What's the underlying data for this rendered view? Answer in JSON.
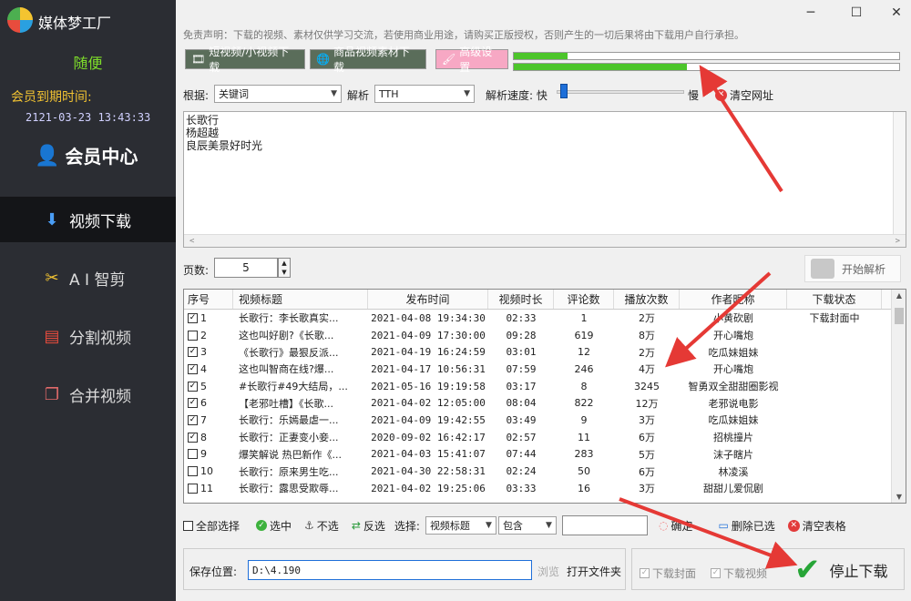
{
  "app": {
    "title": "媒体梦工厂",
    "user": "随便",
    "expiry_label": "会员到期时间:",
    "expiry_value": "2121-03-23 13:43:33",
    "member_center": "会员中心"
  },
  "nav": {
    "items": [
      {
        "label": "视频下载",
        "icon": "down-arrow-icon",
        "active": true
      },
      {
        "label": "A I 智剪",
        "icon": "ai-clip-icon",
        "active": false
      },
      {
        "label": "分割视频",
        "icon": "split-video-icon",
        "active": false
      },
      {
        "label": "合并视频",
        "icon": "merge-video-icon",
        "active": false
      }
    ]
  },
  "window": {
    "minimize": "─",
    "maximize": "☐",
    "close": "✕"
  },
  "disclaimer": "免责声明：下载的视频、素材仅供学习交流，若使用商业用途，请购买正版授权，否则产生的一切后果将由下载用户自行承担。",
  "top_buttons": {
    "short_video": "短视频/小视频下载",
    "product_material": "商品视频素材下载",
    "advanced": "高级设置"
  },
  "progress": {
    "bar1": 0.14,
    "bar2": 0.45
  },
  "parse_options": {
    "by_label": "根据:",
    "by_value": "关键词",
    "parse_label": "解析",
    "parse_value": "TTH",
    "speed_label": "解析速度: 快",
    "speed_slow": "慢",
    "speed_level": 0.03,
    "clear_url": "清空网址"
  },
  "url_lines": [
    "长歌行",
    "杨超越",
    "良辰美景好时光"
  ],
  "pages": {
    "label": "页数:",
    "value": "5",
    "start_parse": "开始解析"
  },
  "table": {
    "columns": [
      "序号",
      "视频标题",
      "发布时间",
      "视频时长",
      "评论数",
      "播放次数",
      "作者昵称",
      "下载状态"
    ],
    "rows": [
      {
        "checked": true,
        "no": "1",
        "title": "长歌行：李长歌真实...",
        "time": "2021-04-08 19:34:30",
        "dur": "02:33",
        "comments": "1",
        "plays": "2万",
        "author": "小黄砍剧",
        "status": "下载封面中"
      },
      {
        "checked": false,
        "no": "2",
        "title": "这也叫好剧?《长歌...",
        "time": "2021-04-09 17:30:00",
        "dur": "09:28",
        "comments": "619",
        "plays": "8万",
        "author": "开心嘴炮",
        "status": ""
      },
      {
        "checked": true,
        "no": "3",
        "title": "《长歌行》最狠反派...",
        "time": "2021-04-19 16:24:59",
        "dur": "03:01",
        "comments": "12",
        "plays": "2万",
        "author": "吃瓜妹姐妹",
        "status": ""
      },
      {
        "checked": true,
        "no": "4",
        "title": "这也叫智商在线?爆...",
        "time": "2021-04-17 10:56:31",
        "dur": "07:59",
        "comments": "246",
        "plays": "4万",
        "author": "开心嘴炮",
        "status": ""
      },
      {
        "checked": true,
        "no": "5",
        "title": "#长歌行#49大结局，...",
        "time": "2021-05-16 19:19:58",
        "dur": "03:17",
        "comments": "8",
        "plays": "3245",
        "author": "智勇双全甜甜圈影视",
        "status": ""
      },
      {
        "checked": true,
        "no": "6",
        "title": "【老邪吐槽】《长歌...",
        "time": "2021-04-02 12:05:00",
        "dur": "08:04",
        "comments": "822",
        "plays": "12万",
        "author": "老邪说电影",
        "status": ""
      },
      {
        "checked": true,
        "no": "7",
        "title": "长歌行：乐嫣最虐一...",
        "time": "2021-04-09 19:42:55",
        "dur": "03:49",
        "comments": "9",
        "plays": "3万",
        "author": "吃瓜妹姐妹",
        "status": ""
      },
      {
        "checked": true,
        "no": "8",
        "title": "长歌行：正妻变小妾...",
        "time": "2020-09-02 16:42:17",
        "dur": "02:57",
        "comments": "11",
        "plays": "6万",
        "author": "招桃撞片",
        "status": ""
      },
      {
        "checked": false,
        "no": "9",
        "title": "爆笑解说 热巴新作《...",
        "time": "2021-04-03 15:41:07",
        "dur": "07:44",
        "comments": "283",
        "plays": "5万",
        "author": "沫子瞎片",
        "status": ""
      },
      {
        "checked": false,
        "no": "10",
        "title": "长歌行：原来男生吃...",
        "time": "2021-04-30 22:58:31",
        "dur": "02:24",
        "comments": "50",
        "plays": "6万",
        "author": "林凌溪",
        "status": ""
      },
      {
        "checked": false,
        "no": "11",
        "title": "长歌行：露思受欺辱...",
        "time": "2021-04-02 19:25:06",
        "dur": "03:33",
        "comments": "16",
        "plays": "3万",
        "author": "甜甜儿爱侃剧",
        "status": ""
      }
    ]
  },
  "toolbar": {
    "select_all": "全部选择",
    "select": "选中",
    "deselect": "不选",
    "invert": "反选",
    "choose_label": "选择:",
    "field": "视频标题",
    "match": "包含",
    "confirm": "确定",
    "delete_selected": "删除已选",
    "clear_table": "清空表格"
  },
  "save": {
    "label": "保存位置:",
    "path": "D:\\4.190",
    "browse": "浏览",
    "open_folder": "打开文件夹"
  },
  "download": {
    "cover": "下载封面",
    "video": "下载视频",
    "stop": "停止下载"
  }
}
